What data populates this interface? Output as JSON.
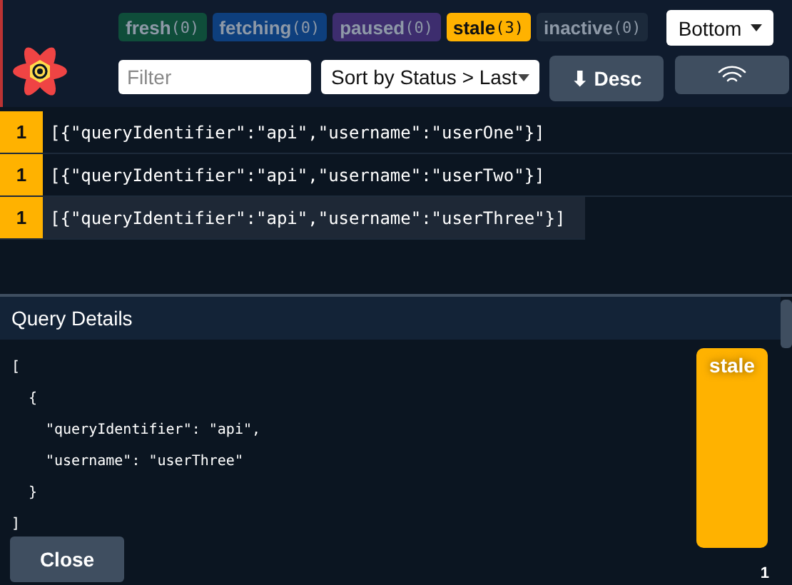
{
  "status_chips": [
    {
      "label": "fresh",
      "count": "(0)",
      "color": "#0f4d3a",
      "disabled": true
    },
    {
      "label": "fetching",
      "count": "(0)",
      "color": "#0e3f7d",
      "disabled": true
    },
    {
      "label": "paused",
      "count": "(0)",
      "color": "#3d2d6e",
      "disabled": true
    },
    {
      "label": "stale",
      "count": "(3)",
      "color": "#ffb200",
      "disabled": false
    },
    {
      "label": "inactive",
      "count": "(0)",
      "color": "#1c2a3b",
      "disabled": true
    }
  ],
  "position_select": {
    "value": "Bottom"
  },
  "filter": {
    "placeholder": "Filter"
  },
  "sort_select": {
    "value": "Sort by Status > Last"
  },
  "sort_direction_button": {
    "label": "⬇ Desc"
  },
  "queries": [
    {
      "observers": "1",
      "key": "[{\"queryIdentifier\":\"api\",\"username\":\"userOne\"}]",
      "selected": false
    },
    {
      "observers": "1",
      "key": "[{\"queryIdentifier\":\"api\",\"username\":\"userTwo\"}]",
      "selected": false
    },
    {
      "observers": "1",
      "key": "[{\"queryIdentifier\":\"api\",\"username\":\"userThree\"}]",
      "selected": true
    }
  ],
  "details": {
    "title": "Query Details",
    "key_lines": [
      {
        "text": "[",
        "children": [
          {
            "text": "{",
            "children": [
              {
                "text": "\"queryIdentifier\": \"api\","
              },
              {
                "text": "\"username\": \"userThree\""
              }
            ]
          },
          {
            "text": "}"
          }
        ]
      },
      {
        "text": "]"
      }
    ],
    "status": "stale",
    "observers": "1",
    "close_button": "Close"
  }
}
